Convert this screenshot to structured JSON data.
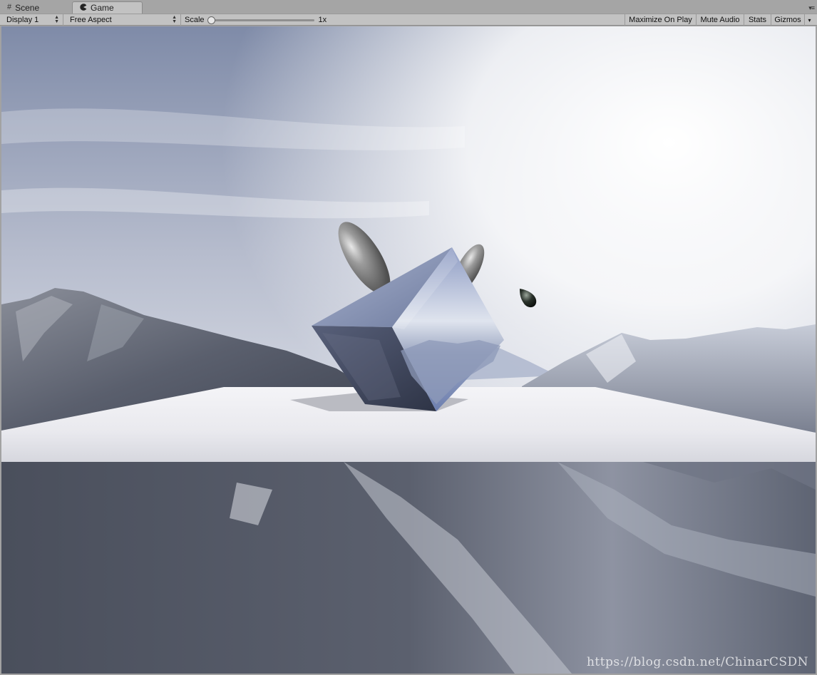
{
  "tabs": [
    {
      "label": "Scene",
      "icon": "grid-icon"
    },
    {
      "label": "Game",
      "icon": "pacman-icon",
      "active": true
    }
  ],
  "toolbar": {
    "display": "Display 1",
    "aspect": "Free Aspect",
    "scale_label": "Scale",
    "scale_value": "1x",
    "scale_level": 0.0,
    "maximize": "Maximize On Play",
    "mute": "Mute Audio",
    "stats": "Stats",
    "gizmos": "Gizmos"
  },
  "viewport": {
    "watermark": "https://blog.csdn.net/ChinarCSDN"
  },
  "colors": {
    "tab_bg": "#a5a5a5",
    "toolbar_bg": "#c2c2c2",
    "sky_top": "#7e8aa6",
    "sky_glow": "#ffffff",
    "plane": "#eeeef2",
    "mountain": "#4b5060"
  }
}
